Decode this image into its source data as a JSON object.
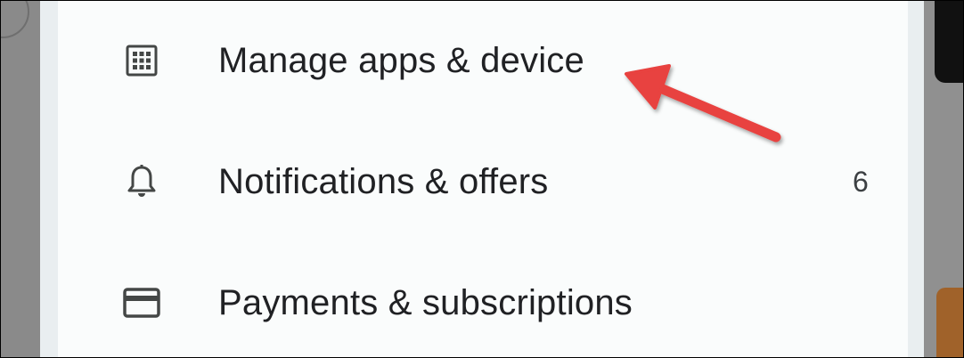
{
  "menu": {
    "items": [
      {
        "label": "Manage apps & device",
        "icon": "grid-icon",
        "badge": ""
      },
      {
        "label": "Notifications & offers",
        "icon": "bell-icon",
        "badge": "6"
      },
      {
        "label": "Payments & subscriptions",
        "icon": "credit-card-icon",
        "badge": ""
      }
    ]
  },
  "colors": {
    "text": "#202124",
    "icon": "#444746",
    "sheet": "#fafcfc",
    "arrow": "#e8423f"
  }
}
